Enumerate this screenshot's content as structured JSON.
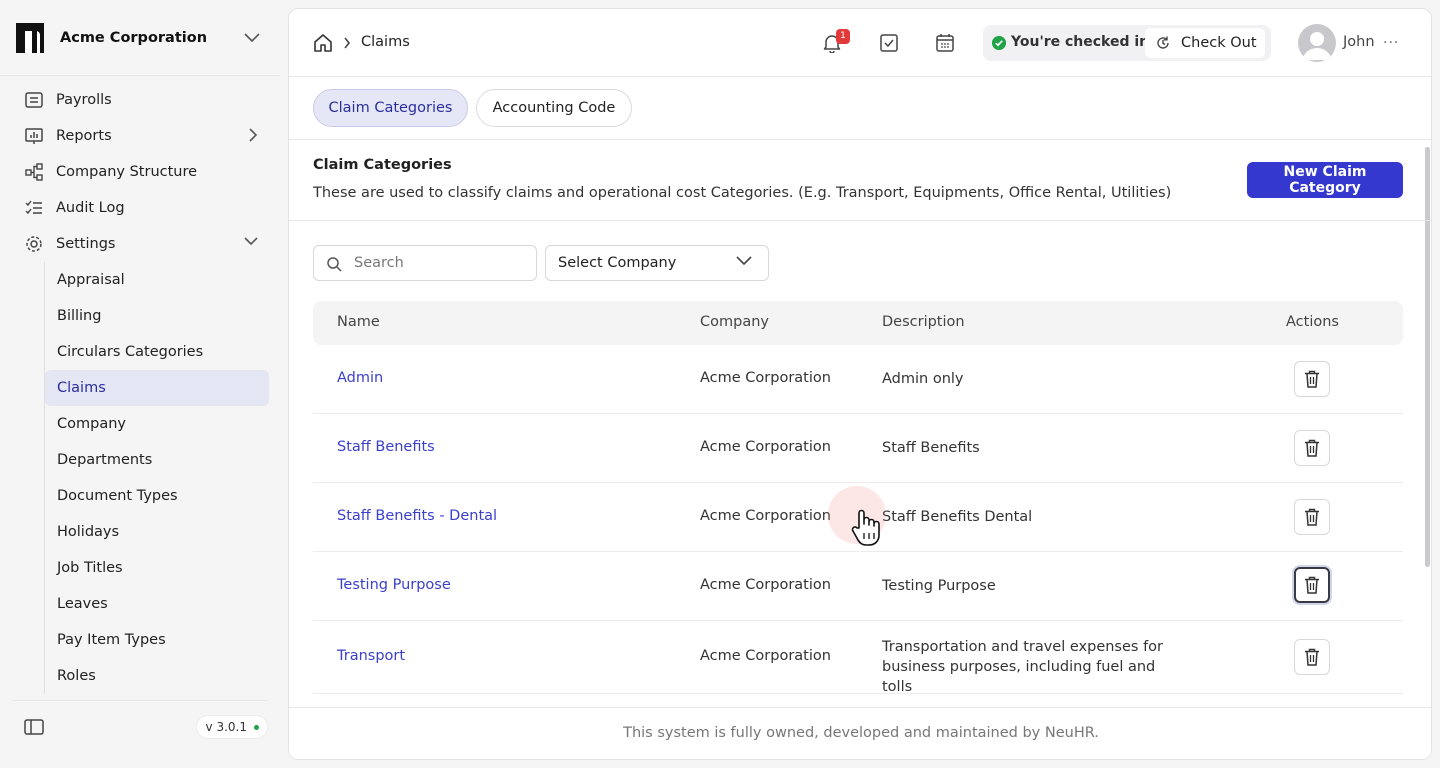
{
  "brand": {
    "name": "Acme Corporation"
  },
  "sidebar": {
    "items": [
      {
        "label": "Payrolls"
      },
      {
        "label": "Reports"
      },
      {
        "label": "Company Structure"
      },
      {
        "label": "Audit Log"
      },
      {
        "label": "Settings"
      }
    ],
    "settings_sub": [
      {
        "label": "Appraisal"
      },
      {
        "label": "Billing"
      },
      {
        "label": "Circulars Categories"
      },
      {
        "label": "Claims"
      },
      {
        "label": "Company"
      },
      {
        "label": "Departments"
      },
      {
        "label": "Document Types"
      },
      {
        "label": "Holidays"
      },
      {
        "label": "Job Titles"
      },
      {
        "label": "Leaves"
      },
      {
        "label": "Pay Item Types"
      },
      {
        "label": "Roles"
      }
    ],
    "active_sub": "Claims",
    "version": "v 3.0.1"
  },
  "header": {
    "breadcrumb": "Claims",
    "notification_count": "1",
    "checkin_status": "You're checked in",
    "checkout_label": "Check Out",
    "user_name": "John",
    "more": "···"
  },
  "tabs": [
    {
      "label": "Claim Categories",
      "active": true
    },
    {
      "label": "Accounting Code",
      "active": false
    }
  ],
  "section": {
    "title": "Claim Categories",
    "description": "These are used to classify claims and operational cost Categories. (E.g. Transport, Equipments, Office Rental, Utilities)",
    "new_button": "New Claim Category"
  },
  "filters": {
    "search_placeholder": "Search",
    "company_select": "Select Company"
  },
  "table": {
    "columns": {
      "name": "Name",
      "company": "Company",
      "description": "Description",
      "actions": "Actions"
    },
    "rows": [
      {
        "name": "Admin",
        "company": "Acme Corporation",
        "description": "Admin only"
      },
      {
        "name": "Staff Benefits",
        "company": "Acme Corporation",
        "description": "Staff Benefits"
      },
      {
        "name": "Staff Benefits - Dental",
        "company": "Acme Corporation",
        "description": "Staff Benefits Dental"
      },
      {
        "name": "Testing Purpose",
        "company": "Acme Corporation",
        "description": "Testing Purpose"
      },
      {
        "name": "Transport",
        "company": "Acme Corporation",
        "description": "Transportation and travel expenses for business purposes, including fuel and tolls"
      }
    ]
  },
  "footer": {
    "text": "This system is fully owned, developed and maintained by NeuHR."
  },
  "colors": {
    "accent": "#3538cf",
    "link": "#3a3fcc",
    "active_bg": "#e5e6f3",
    "success": "#22a34a",
    "badge": "#e23a3a"
  }
}
